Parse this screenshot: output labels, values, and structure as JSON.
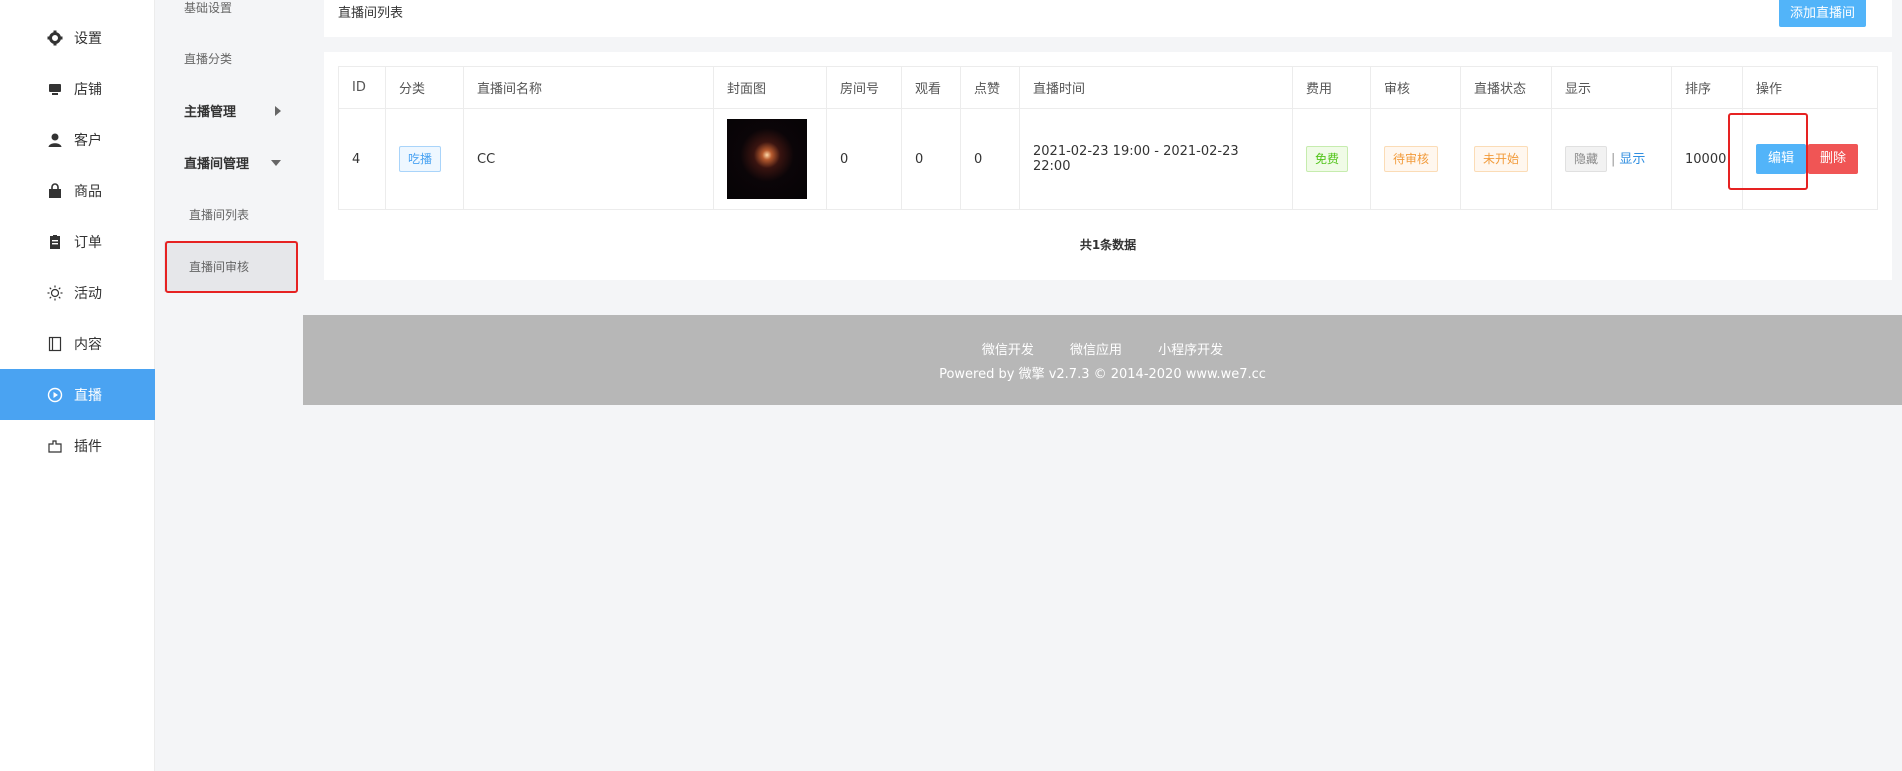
{
  "nav": {
    "items": [
      {
        "label": "设置",
        "icon": "gear-icon"
      },
      {
        "label": "店铺",
        "icon": "store-icon"
      },
      {
        "label": "客户",
        "icon": "user-icon"
      },
      {
        "label": "商品",
        "icon": "bag-icon"
      },
      {
        "label": "订单",
        "icon": "clipboard-icon"
      },
      {
        "label": "活动",
        "icon": "sun-icon"
      },
      {
        "label": "内容",
        "icon": "book-icon"
      },
      {
        "label": "直播",
        "icon": "play-circle-icon",
        "active": true
      },
      {
        "label": "插件",
        "icon": "plugin-icon"
      }
    ]
  },
  "subnav": {
    "basic_settings": "基础设置",
    "live_category": "直播分类",
    "anchor_mgmt": "主播管理",
    "room_mgmt": "直播间管理",
    "room_list": "直播间列表",
    "room_review": "直播间审核"
  },
  "header": {
    "title": "直播间列表",
    "add_button": "添加直播间"
  },
  "table": {
    "columns": [
      "ID",
      "分类",
      "直播间名称",
      "封面图",
      "房间号",
      "观看",
      "点赞",
      "直播时间",
      "费用",
      "审核",
      "直播状态",
      "显示",
      "排序",
      "操作"
    ],
    "rows": [
      {
        "id": "4",
        "category": "吃播",
        "name": "CC",
        "room_no": "0",
        "views": "0",
        "likes": "0",
        "time": "2021-02-23 19:00 - 2021-02-23 22:00",
        "fee": "免费",
        "review": "待审核",
        "status": "未开始",
        "hide": "隐藏",
        "sep": "|",
        "show": "显示",
        "sort": "10000",
        "edit": "编辑",
        "delete": "删除"
      }
    ],
    "total": "共1条数据"
  },
  "footer": {
    "link1": "微信开发",
    "link2": "微信应用",
    "link3": "小程序开发",
    "copyright": "Powered by 微擎 v2.7.3 © 2014-2020 www.we7.cc"
  },
  "colors": {
    "accent": "#4aa3f2",
    "danger": "#f05555",
    "highlight_box": "#e62222"
  }
}
